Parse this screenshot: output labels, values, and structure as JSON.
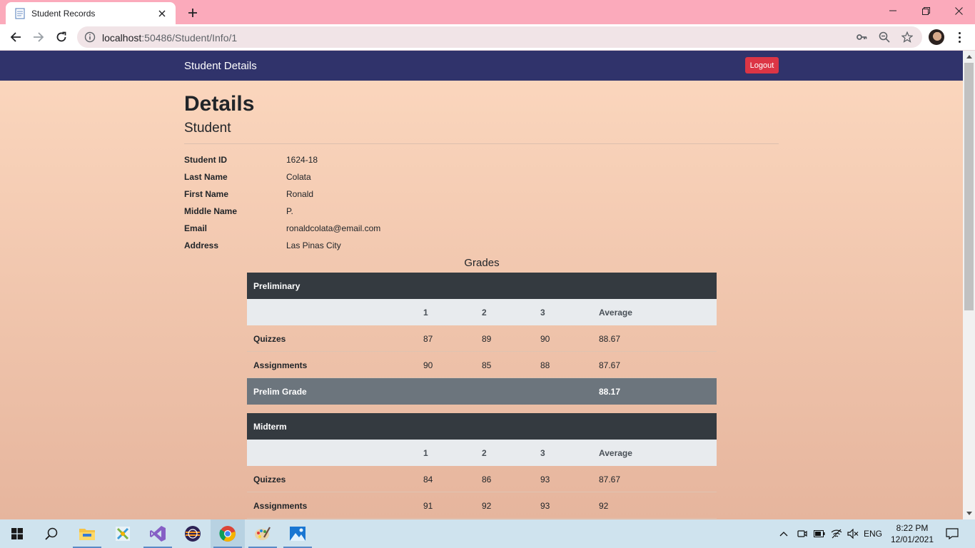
{
  "browser": {
    "tab_title": "Student Records",
    "url_host": "localhost",
    "url_rest": ":50486/Student/Info/1"
  },
  "navbar": {
    "brand": "Student Details",
    "logout_label": "Logout"
  },
  "page": {
    "title": "Details",
    "subtitle": "Student"
  },
  "student": [
    {
      "label": "Student ID",
      "value": "1624-18"
    },
    {
      "label": "Last Name",
      "value": "Colata"
    },
    {
      "label": "First Name",
      "value": "Ronald"
    },
    {
      "label": "Middle Name",
      "value": "P."
    },
    {
      "label": "Email",
      "value": "ronaldcolata@email.com"
    },
    {
      "label": "Address",
      "value": "Las Pinas City"
    }
  ],
  "grades": {
    "title": "Grades",
    "columns": [
      "1",
      "2",
      "3",
      "Average"
    ],
    "periods": [
      {
        "name": "Preliminary",
        "rows": [
          {
            "label": "Quizzes",
            "values": [
              "87",
              "89",
              "90",
              "88.67"
            ]
          },
          {
            "label": "Assignments",
            "values": [
              "90",
              "85",
              "88",
              "87.67"
            ]
          }
        ],
        "footer_label": "Prelim Grade",
        "footer_value": "88.17"
      },
      {
        "name": "Midterm",
        "rows": [
          {
            "label": "Quizzes",
            "values": [
              "84",
              "86",
              "93",
              "87.67"
            ]
          },
          {
            "label": "Assignments",
            "values": [
              "91",
              "92",
              "93",
              "92"
            ]
          }
        ]
      }
    ]
  },
  "taskbar": {
    "language": "ENG",
    "time": "8:22 PM",
    "date": "12/01/2021"
  },
  "colors": {
    "navbar": "#30336b",
    "logout": "#dc3545",
    "table_header": "#343a40",
    "table_footer": "#6c757d",
    "tabstrip": "#fbaabb"
  }
}
